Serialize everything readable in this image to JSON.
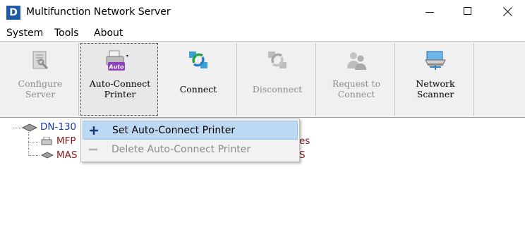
{
  "window": {
    "title": "Multifunction Network Server",
    "app_icon_letter": "D",
    "accent": "#1e5aa8"
  },
  "menu": [
    "System",
    "Tools",
    "About"
  ],
  "toolbar": {
    "configure": {
      "line1": "Configure",
      "line2": "Server",
      "enabled": false,
      "icon": "configure-server-icon"
    },
    "auto_connect": {
      "line1": "Auto-Connect",
      "line2": "Printer",
      "enabled": true,
      "icon": "auto-connect-printer-icon",
      "badge": "Auto"
    },
    "connect": {
      "line1": "Connect",
      "line2": "",
      "enabled": true,
      "icon": "connect-icon"
    },
    "disconnect": {
      "line1": "Disconnect",
      "line2": "",
      "enabled": false,
      "icon": "disconnect-icon"
    },
    "request": {
      "line1": "Request to",
      "line2": "Connect",
      "enabled": false,
      "icon": "request-to-connect-icon"
    },
    "scanner": {
      "line1": "Network",
      "line2": "Scanner",
      "enabled": true,
      "icon": "network-scanner-icon"
    }
  },
  "tree": {
    "root": "DN-130",
    "children": [
      "MFP",
      "MAS"
    ],
    "right_fragments": [
      "es",
      "S"
    ]
  },
  "context_menu": {
    "items": [
      {
        "label": "Set Auto-Connect Printer",
        "enabled": true,
        "selected": true,
        "icon": "plus-icon"
      },
      {
        "label": "Delete Auto-Connect Printer",
        "enabled": false,
        "selected": false,
        "icon": "minus-icon"
      }
    ]
  }
}
